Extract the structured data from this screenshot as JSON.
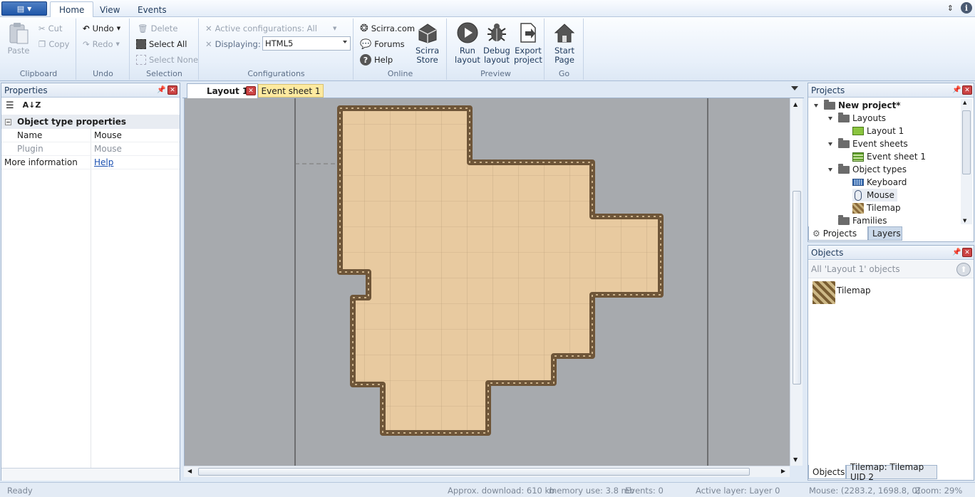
{
  "ribbon_tabs": [
    "Home",
    "View",
    "Events"
  ],
  "clipboard": {
    "paste": "Paste",
    "cut": "Cut",
    "copy": "Copy",
    "label": "Clipboard"
  },
  "undo": {
    "undo": "Undo",
    "redo": "Redo",
    "label": "Undo"
  },
  "selection": {
    "delete": "Delete",
    "select_all": "Select All",
    "select_none": "Select None",
    "label": "Selection"
  },
  "configurations": {
    "active": "Active configurations: All",
    "displaying_label": "Displaying:",
    "displaying_value": "HTML5",
    "label": "Configurations"
  },
  "online": {
    "scirra": "Scirra.com",
    "forums": "Forums",
    "help": "Help",
    "store_line1": "Scirra",
    "store_line2": "Store",
    "label": "Online"
  },
  "preview": {
    "run1": "Run",
    "run2": "layout",
    "debug1": "Debug",
    "debug2": "layout",
    "export1": "Export",
    "export2": "project",
    "label": "Preview"
  },
  "go": {
    "start1": "Start",
    "start2": "Page",
    "label": "Go"
  },
  "properties": {
    "title": "Properties",
    "section": "Object type properties",
    "rows": [
      {
        "name": "Name",
        "value": "Mouse"
      },
      {
        "name": "Plugin",
        "value": "Mouse"
      }
    ],
    "more_info_label": "More information",
    "more_info_link": "Help"
  },
  "doc_tabs": [
    "Layout 1",
    "Event sheet 1"
  ],
  "projects": {
    "title": "Projects",
    "tree": {
      "root": "New project*",
      "layouts": "Layouts",
      "layout1": "Layout 1",
      "event_sheets": "Event sheets",
      "event_sheet1": "Event sheet 1",
      "object_types": "Object types",
      "keyboard": "Keyboard",
      "mouse": "Mouse",
      "tilemap": "Tilemap",
      "families": "Families"
    },
    "tabs": [
      "Projects",
      "Layers"
    ]
  },
  "objects": {
    "title": "Objects",
    "filter": "All 'Layout 1' objects",
    "items": [
      "Tilemap"
    ],
    "tabs": [
      "Objects",
      "Tilemap: Tilemap UID 2"
    ]
  },
  "status": {
    "ready": "Ready",
    "download": "Approx. download: 610 kb",
    "memory": "memory use: 3.8 mb",
    "events": "Events: 0",
    "layer": "Active layer: Layer 0",
    "mouse": "Mouse: (2283.2, 1698.8, 0)",
    "zoom": "Zoom: 29%"
  },
  "colors": {
    "accent": "#1e56a8",
    "tile_fill": "#e8caa0",
    "tile_border": "#6e5538",
    "canvas_bg": "#a7aaae"
  }
}
